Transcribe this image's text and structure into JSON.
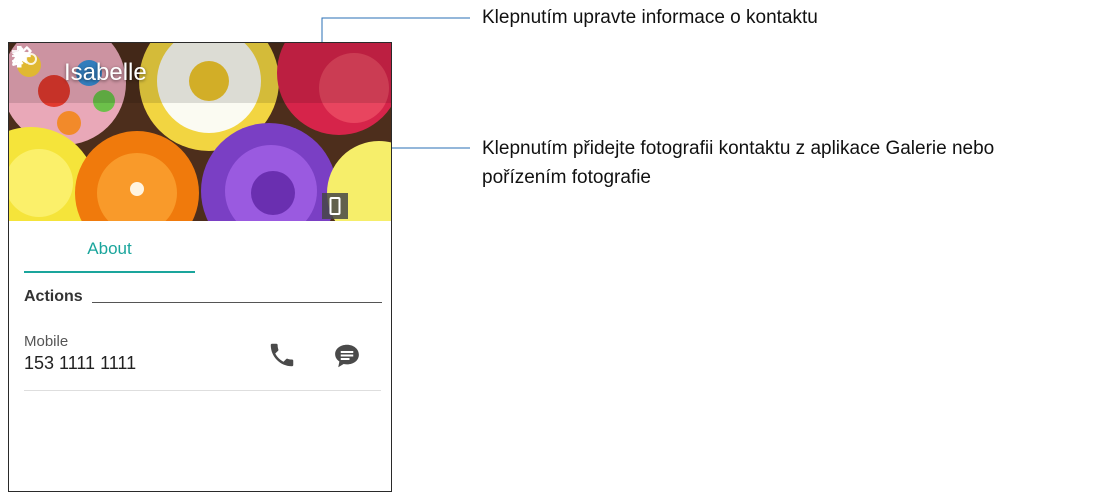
{
  "contact": {
    "name": "Isabelle",
    "tab_about": "About",
    "actions_heading": "Actions",
    "phone_type": "Mobile",
    "phone_number": "153 1111 1111"
  },
  "annotations": {
    "edit_callout": "Klepnutím upravte informace o kontaktu",
    "photo_callout_line1": "Klepnutím přidejte fotografii kontaktu z aplikace Galerie nebo",
    "photo_callout_line2": "pořízením fotografie"
  },
  "colors": {
    "accent": "#1aa59c",
    "icon_gray": "#4a4a4a",
    "leader_line": "#2a6fb5"
  },
  "icons": {
    "back": "arrow-left-icon",
    "favorite": "star-icon",
    "edit": "pencil-icon",
    "more": "more-vert-icon",
    "call": "phone-icon",
    "message": "message-icon"
  }
}
